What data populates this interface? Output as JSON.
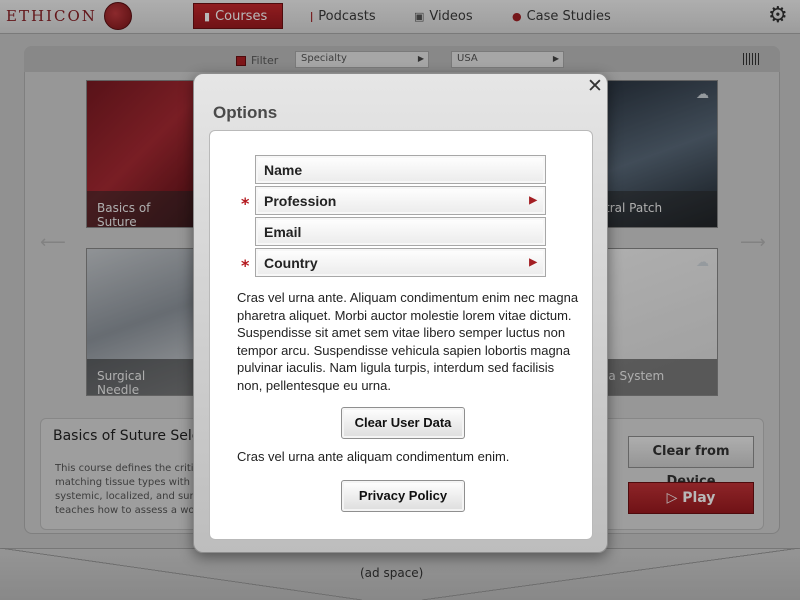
{
  "brand": {
    "name": "ETHICON"
  },
  "nav": {
    "items": [
      {
        "label": "Courses",
        "active": true,
        "icon": "book-icon"
      },
      {
        "label": "Podcasts",
        "active": false,
        "icon": "microphone-icon"
      },
      {
        "label": "Videos",
        "active": false,
        "icon": "film-icon"
      },
      {
        "label": "Case Studies",
        "active": false,
        "icon": "pin-icon"
      }
    ],
    "settings_icon": "gear-icon"
  },
  "filter": {
    "label": "Filter",
    "specialty": "Specialty",
    "country": "USA"
  },
  "tiles": [
    {
      "caption": "Basics of Suture"
    },
    {
      "caption": "tral Patch"
    },
    {
      "caption": "Surgical Needle"
    },
    {
      "caption": "ia System"
    }
  ],
  "detail": {
    "title": "Basics of Suture Sele",
    "description_lines": [
      "This course defines the criti",
      "matching tissue types with",
      "systemic, localized, and sur",
      "teaches how to assess a wo"
    ],
    "clear_label": "Clear from Device",
    "play_label": "Play"
  },
  "ad": {
    "label": "(ad space)"
  },
  "modal": {
    "title": "Options",
    "close_symbol": "✕",
    "fields": [
      {
        "label": "Name",
        "required": false,
        "dropdown": false
      },
      {
        "label": "Profession",
        "required": true,
        "dropdown": true
      },
      {
        "label": "Email",
        "required": false,
        "dropdown": false
      },
      {
        "label": "Country",
        "required": true,
        "dropdown": true
      }
    ],
    "required_mark": "*",
    "paragraph1": "Cras vel urna ante. Aliquam condimentum enim nec magna pharetra aliquet. Morbi auctor molestie lorem vitae dictum. Suspendisse sit amet sem vitae libero semper luctus non tempor arcu. Suspendisse vehicula sapien lobortis magna pulvinar iaculis. Nam ligula turpis, interdum sed facilisis non, pellentesque eu urna.",
    "clear_button": "Clear User Data",
    "paragraph2": "Cras vel urna ante aliquam condimentum enim.",
    "privacy_button": "Privacy Policy"
  },
  "colors": {
    "accent": "#a31e23",
    "modal_bg": "#d4d4d4"
  }
}
